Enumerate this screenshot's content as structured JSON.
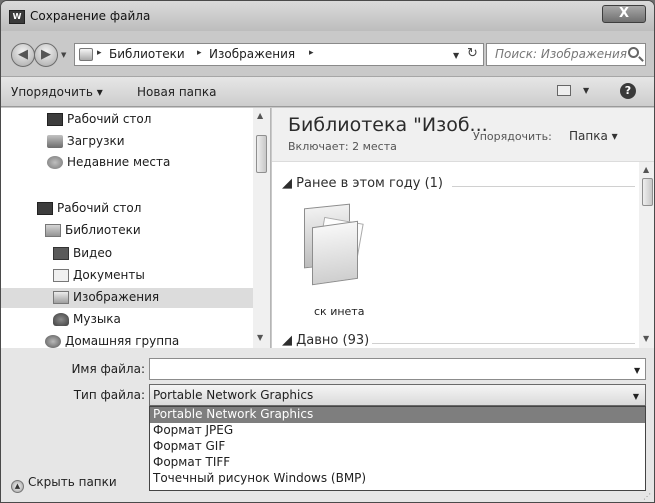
{
  "window": {
    "app_icon_text": "W",
    "title": "Сохранение файла",
    "close_glyph": "X"
  },
  "address": {
    "root_sep": "▸",
    "crumbs": [
      "Библиотеки",
      "Изображения"
    ],
    "refresh_glyph": "↻"
  },
  "search": {
    "placeholder": "Поиск: Изображения"
  },
  "toolbar": {
    "organize": "Упорядочить ▾",
    "new_folder": "Новая папка",
    "help": "?"
  },
  "nav": {
    "items": [
      {
        "label": "Рабочий стол",
        "icon": "desktop-icon"
      },
      {
        "label": "Загрузки",
        "icon": "downloads-icon"
      },
      {
        "label": "Недавние места",
        "icon": "recent-places-icon"
      },
      {
        "label": "Рабочий стол",
        "icon": "desktop-icon"
      },
      {
        "label": "Библиотеки",
        "icon": "libraries-icon"
      },
      {
        "label": "Видео",
        "icon": "video-icon"
      },
      {
        "label": "Документы",
        "icon": "documents-icon"
      },
      {
        "label": "Изображения",
        "icon": "pictures-icon"
      },
      {
        "label": "Музыка",
        "icon": "music-icon"
      },
      {
        "label": "Домашняя группа",
        "icon": "homegroup-icon"
      }
    ],
    "selected_index": 7
  },
  "content": {
    "library_title": "Библиотека \"Изоб...",
    "library_sub": "Включает: 2 места",
    "arrange_label": "Упорядочить:",
    "arrange_value": "Папка ▾",
    "groups": [
      {
        "header": "Ранее в этом году (1)"
      },
      {
        "header": "Давно (93)"
      }
    ],
    "folder_name": "ск инета"
  },
  "form": {
    "filename_label": "Имя файла:",
    "filename_value": "",
    "filetype_label": "Тип файла:",
    "filetype_value": "Portable Network Graphics",
    "filetype_options": [
      "Portable Network Graphics",
      "Формат JPEG",
      "Формат GIF",
      "Формат TIFF",
      "Точечный рисунок Windows (BMP)"
    ],
    "highlighted_index": 0,
    "hide_folders": "Скрыть папки"
  }
}
